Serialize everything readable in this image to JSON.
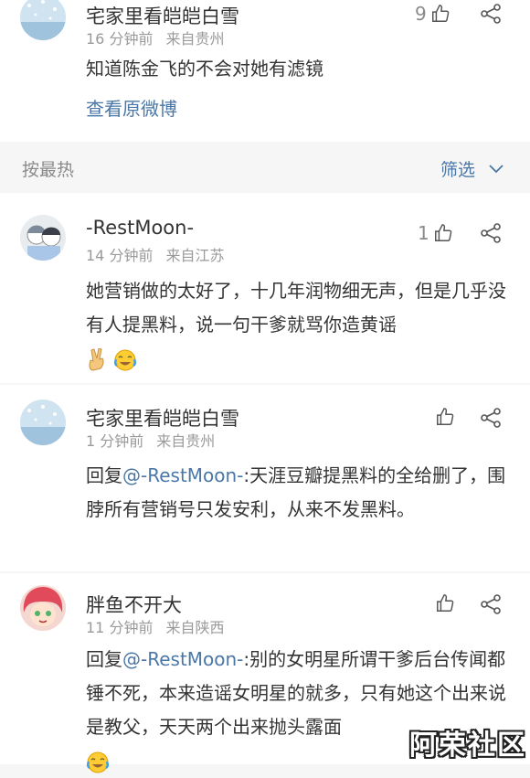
{
  "post": {
    "author": "宅家里看皑皑白雪",
    "time": "16 分钟前",
    "location": "来自贵州",
    "text": "知道陈金飞的不会对她有滤镜",
    "like_count": "9",
    "view_original": "查看原微博"
  },
  "sort_bar": {
    "label": "按最热",
    "filter_label": "筛选"
  },
  "comments": [
    {
      "author": "-RestMoon-",
      "time": "14 分钟前",
      "location": "来自江苏",
      "like_count": "1",
      "text": "她营销做的太好了，十几年润物细无声，但是几乎没有人提黑料，说一句干爹就骂你造黄谣",
      "emojis": [
        "victory-hand-emoji",
        "crying-laughing-emoji"
      ]
    },
    {
      "author": "宅家里看皑皑白雪",
      "time": "1 分钟前",
      "location": "来自贵州",
      "like_count": "",
      "reply_prefix": "回复",
      "mention": "@-RestMoon-",
      "text": ":天涯豆瓣提黑料的全给删了，围脖所有营销号只发安利，从来不发黑料。"
    },
    {
      "author": "胖鱼不开大",
      "time": "11 分钟前",
      "location": "来自陕西",
      "like_count": "",
      "reply_prefix": "回复",
      "mention": "@-RestMoon-",
      "text": ":别的女明星所谓干爹后台传闻都锤不死，本来造谣女明星的就多，只有她这个出来说是教父，天天两个出来抛头露面",
      "emojis": [
        "crying-laughing-emoji"
      ]
    }
  ],
  "watermark": "阿荣社区",
  "colors": {
    "link": "#4a77a7",
    "background": "#f6f6f6",
    "secondary_text": "#9a9a9a"
  },
  "icons": [
    "thumbs-up-icon",
    "share-icon",
    "chevron-down-icon"
  ]
}
